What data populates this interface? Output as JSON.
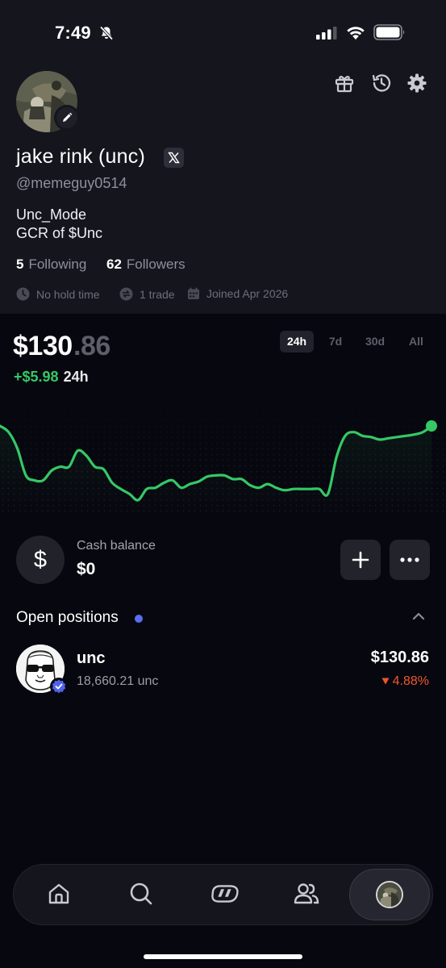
{
  "status_bar": {
    "time": "7:49"
  },
  "profile": {
    "display_name": "jake rink (unc)",
    "handle": "@memeguy0514",
    "bio_lines": [
      "Unc_Mode",
      "GCR of $Unc"
    ],
    "following_count": "5",
    "following_label": "Following",
    "followers_count": "62",
    "followers_label": "Followers",
    "meta": {
      "hold_time": "No hold time",
      "trades": "1 trade",
      "joined": "Joined Apr 2026"
    }
  },
  "portfolio": {
    "value_whole": "$130",
    "value_cents": ".86",
    "change_amount": "+$5.98",
    "change_period": "24h",
    "ranges": [
      "24h",
      "7d",
      "30d",
      "All"
    ],
    "selected_range": "24h"
  },
  "chart_data": {
    "type": "line",
    "x": [
      0,
      1,
      2,
      3,
      4,
      5,
      6,
      7,
      8,
      9,
      10,
      11,
      12,
      13,
      14,
      15,
      16,
      17,
      18,
      19,
      20,
      21,
      22,
      23,
      24,
      25,
      26,
      27,
      28,
      29,
      30,
      31,
      32,
      33,
      34,
      35,
      36,
      37,
      38,
      39,
      40,
      41,
      42,
      43,
      44,
      45,
      46,
      47,
      48,
      49,
      50
    ],
    "values": [
      130.0,
      129.5,
      128.2,
      126.0,
      125.6,
      125.6,
      126.4,
      126.7,
      126.7,
      128.0,
      127.6,
      126.7,
      126.5,
      125.4,
      124.9,
      124.5,
      124.0,
      124.9,
      125.0,
      125.4,
      125.6,
      125.0,
      125.3,
      125.5,
      125.9,
      126.0,
      126.0,
      125.7,
      125.7,
      125.2,
      125.0,
      125.3,
      125.0,
      124.8,
      124.9,
      124.9,
      124.9,
      124.9,
      124.5,
      127.5,
      129.2,
      129.5,
      129.2,
      129.1,
      128.9,
      129.0,
      129.1,
      129.2,
      129.3,
      129.5,
      130.0
    ],
    "series_color": "#35c866",
    "grid": false,
    "axes_visible": false
  },
  "cash": {
    "label": "Cash balance",
    "value": "$0",
    "symbol": "$"
  },
  "positions": {
    "title": "Open positions",
    "items": [
      {
        "name": "unc",
        "amount": "18,660.21 unc",
        "value": "$130.86",
        "change": "4.88%",
        "direction": "down"
      }
    ]
  },
  "nav": {
    "items": [
      "home-icon",
      "search-icon",
      "trade-icon",
      "community-icon",
      "profile-avatar"
    ]
  },
  "colors": {
    "positive": "#35c866",
    "negative": "#f0562e",
    "accent": "#5a6cf0",
    "background": "#07070f",
    "panel": "#15151e"
  }
}
